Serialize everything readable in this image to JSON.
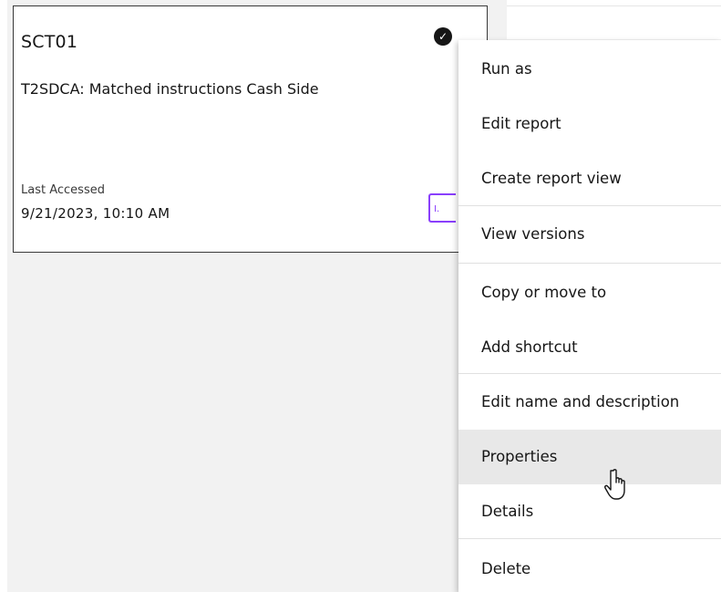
{
  "card": {
    "title": "SCT01",
    "description": "T2SDCA: Matched instructions Cash Side",
    "last_accessed_label": "Last Accessed",
    "last_accessed_value": "9/21/2023, 10:10 AM",
    "check_icon": "checkmark-filled-icon",
    "report_icon": "report-icon",
    "accent_color": "#8a3ffc"
  },
  "menu": {
    "items": [
      {
        "label": "Run as"
      },
      {
        "label": "Edit report"
      },
      {
        "label": "Create report view"
      },
      {
        "label": "View versions"
      },
      {
        "label": "Copy or move to"
      },
      {
        "label": "Add shortcut"
      },
      {
        "label": "Edit name and description"
      },
      {
        "label": "Properties",
        "hovered": true
      },
      {
        "label": "Details"
      },
      {
        "label": "Delete"
      }
    ]
  },
  "cursor": "hand-pointer-icon"
}
